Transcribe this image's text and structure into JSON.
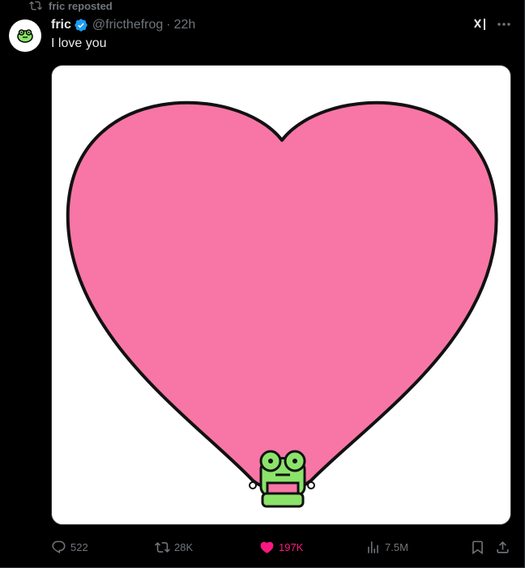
{
  "repost_banner": {
    "text": "fric reposted",
    "icon": "repost-icon"
  },
  "author": {
    "name": "fric",
    "handle": "@fricthefrog",
    "separator": "·",
    "time": "22h",
    "verified": true,
    "verified_color": "#1d9bf0"
  },
  "tweet": {
    "text": "I love you"
  },
  "media": {
    "description_icon": "pink-heart-frog-image",
    "heart_color": "#f776a6",
    "frog_color": "#8be36a"
  },
  "actions": {
    "reply": {
      "count": "522",
      "icon": "reply-icon"
    },
    "repost": {
      "count": "28K",
      "icon": "repost-icon"
    },
    "like": {
      "count": "197K",
      "icon": "heart-icon",
      "active": true,
      "color": "#f91880"
    },
    "views": {
      "count": "7.5M",
      "icon": "views-icon"
    },
    "bookmark": {
      "icon": "bookmark-icon"
    },
    "share": {
      "icon": "share-icon"
    }
  },
  "colors": {
    "background": "#000000",
    "text": "#e7e9ea",
    "muted": "#71767b",
    "border": "#2f3336"
  }
}
